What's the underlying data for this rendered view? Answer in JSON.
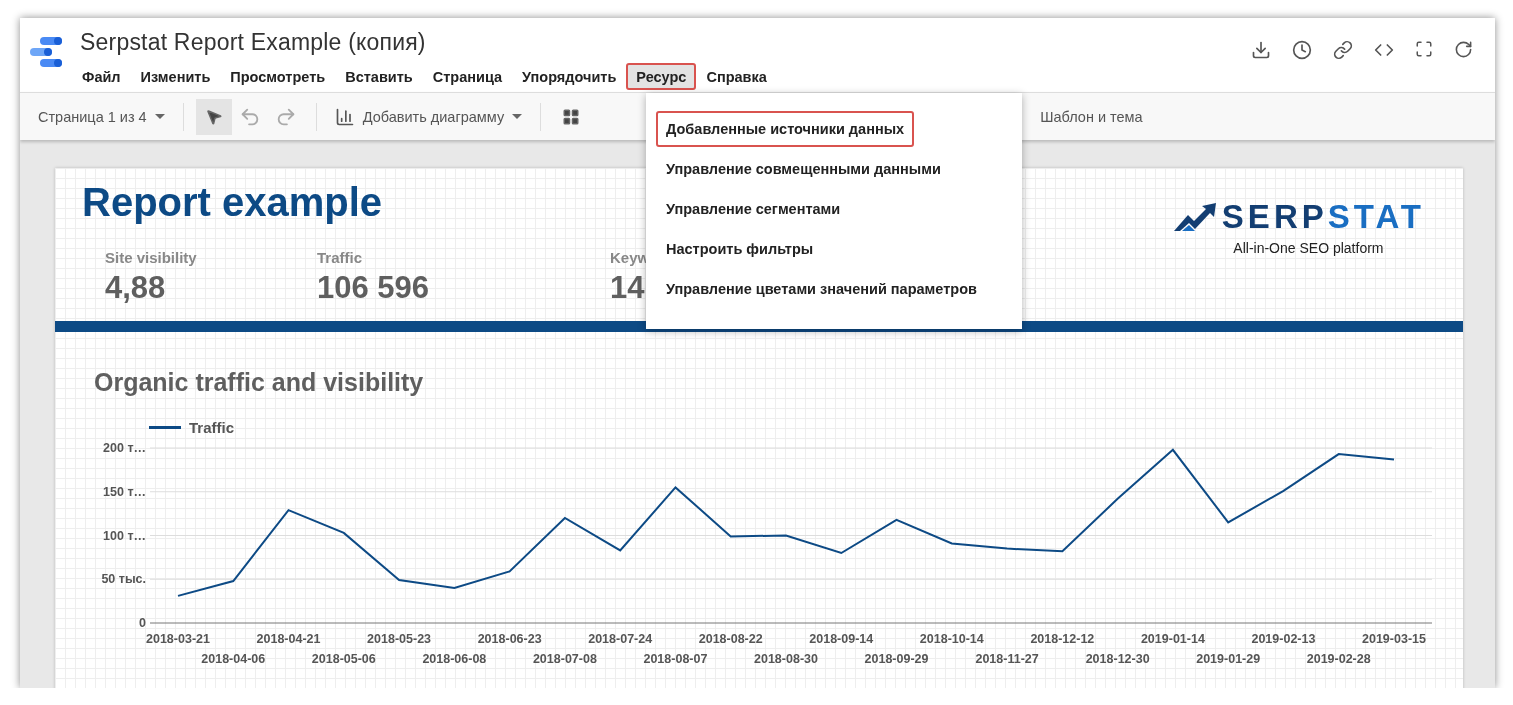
{
  "window": {
    "title": "Serpstat Report Example (копия)"
  },
  "menu_bar": [
    {
      "label": "Файл",
      "selected": false,
      "highlighted": false
    },
    {
      "label": "Изменить",
      "selected": false,
      "highlighted": false
    },
    {
      "label": "Просмотреть",
      "selected": false,
      "highlighted": false
    },
    {
      "label": "Вставить",
      "selected": false,
      "highlighted": false
    },
    {
      "label": "Страница",
      "selected": false,
      "highlighted": false
    },
    {
      "label": "Упорядочить",
      "selected": false,
      "highlighted": false
    },
    {
      "label": "Ресурс",
      "selected": true,
      "highlighted": true
    },
    {
      "label": "Справка",
      "selected": false,
      "highlighted": false
    }
  ],
  "toolbar": {
    "page_selector": "Страница 1 из 4",
    "add_chart": "Добавить диаграмму",
    "theme": "Шаблон и тема"
  },
  "open_menu": {
    "items": [
      {
        "label": "Добавленные источники данных",
        "highlighted": true
      },
      {
        "label": "Управление совмещенными данными",
        "highlighted": false
      },
      {
        "label": "Управление сегментами",
        "highlighted": false
      },
      {
        "label": "Настроить фильтры",
        "highlighted": false
      },
      {
        "label": "Управление цветами значений параметров",
        "highlighted": false
      }
    ]
  },
  "report": {
    "title": "Report example",
    "logo": {
      "text_primary": "SERP",
      "text_accent": "STAT",
      "tagline": "All-in-One SEO platform"
    },
    "scorecards": [
      {
        "label": "Site visibility",
        "value": "4,88"
      },
      {
        "label": "Traffic",
        "value": "106 596"
      },
      {
        "label": "Keyw",
        "value": "14"
      }
    ],
    "chart": {
      "title": "Organic traffic and visibility",
      "chart_data": {
        "type": "line",
        "categories": [
          "2018-03-21",
          "2018-04-06",
          "2018-04-21",
          "2018-05-06",
          "2018-05-23",
          "2018-06-08",
          "2018-06-23",
          "2018-07-08",
          "2018-07-24",
          "2018-08-07",
          "2018-08-22",
          "2018-08-30",
          "2018-09-14",
          "2018-09-29",
          "2018-10-14",
          "2018-11-27",
          "2018-12-12",
          "2018-12-30",
          "2019-01-14",
          "2019-01-29",
          "2019-02-13",
          "2019-02-28",
          "2019-03-15"
        ],
        "series": [
          {
            "name": "Traffic",
            "color": "#0d4a85",
            "values": [
              31,
              48,
              129,
              103,
              49,
              40,
              59,
              120,
              83,
              155,
              99,
              100,
              80,
              118,
              91,
              85,
              82,
              142,
              198,
              115,
              151,
              193,
              187
            ]
          }
        ],
        "ylim": [
          0,
          200
        ],
        "grid": true,
        "yticks": [
          {
            "value": 0,
            "label": "0"
          },
          {
            "value": 50,
            "label": "50 тыс."
          },
          {
            "value": 100,
            "label": "100 т…"
          },
          {
            "value": 150,
            "label": "150 т…"
          },
          {
            "value": 200,
            "label": "200 т…"
          }
        ]
      }
    }
  }
}
